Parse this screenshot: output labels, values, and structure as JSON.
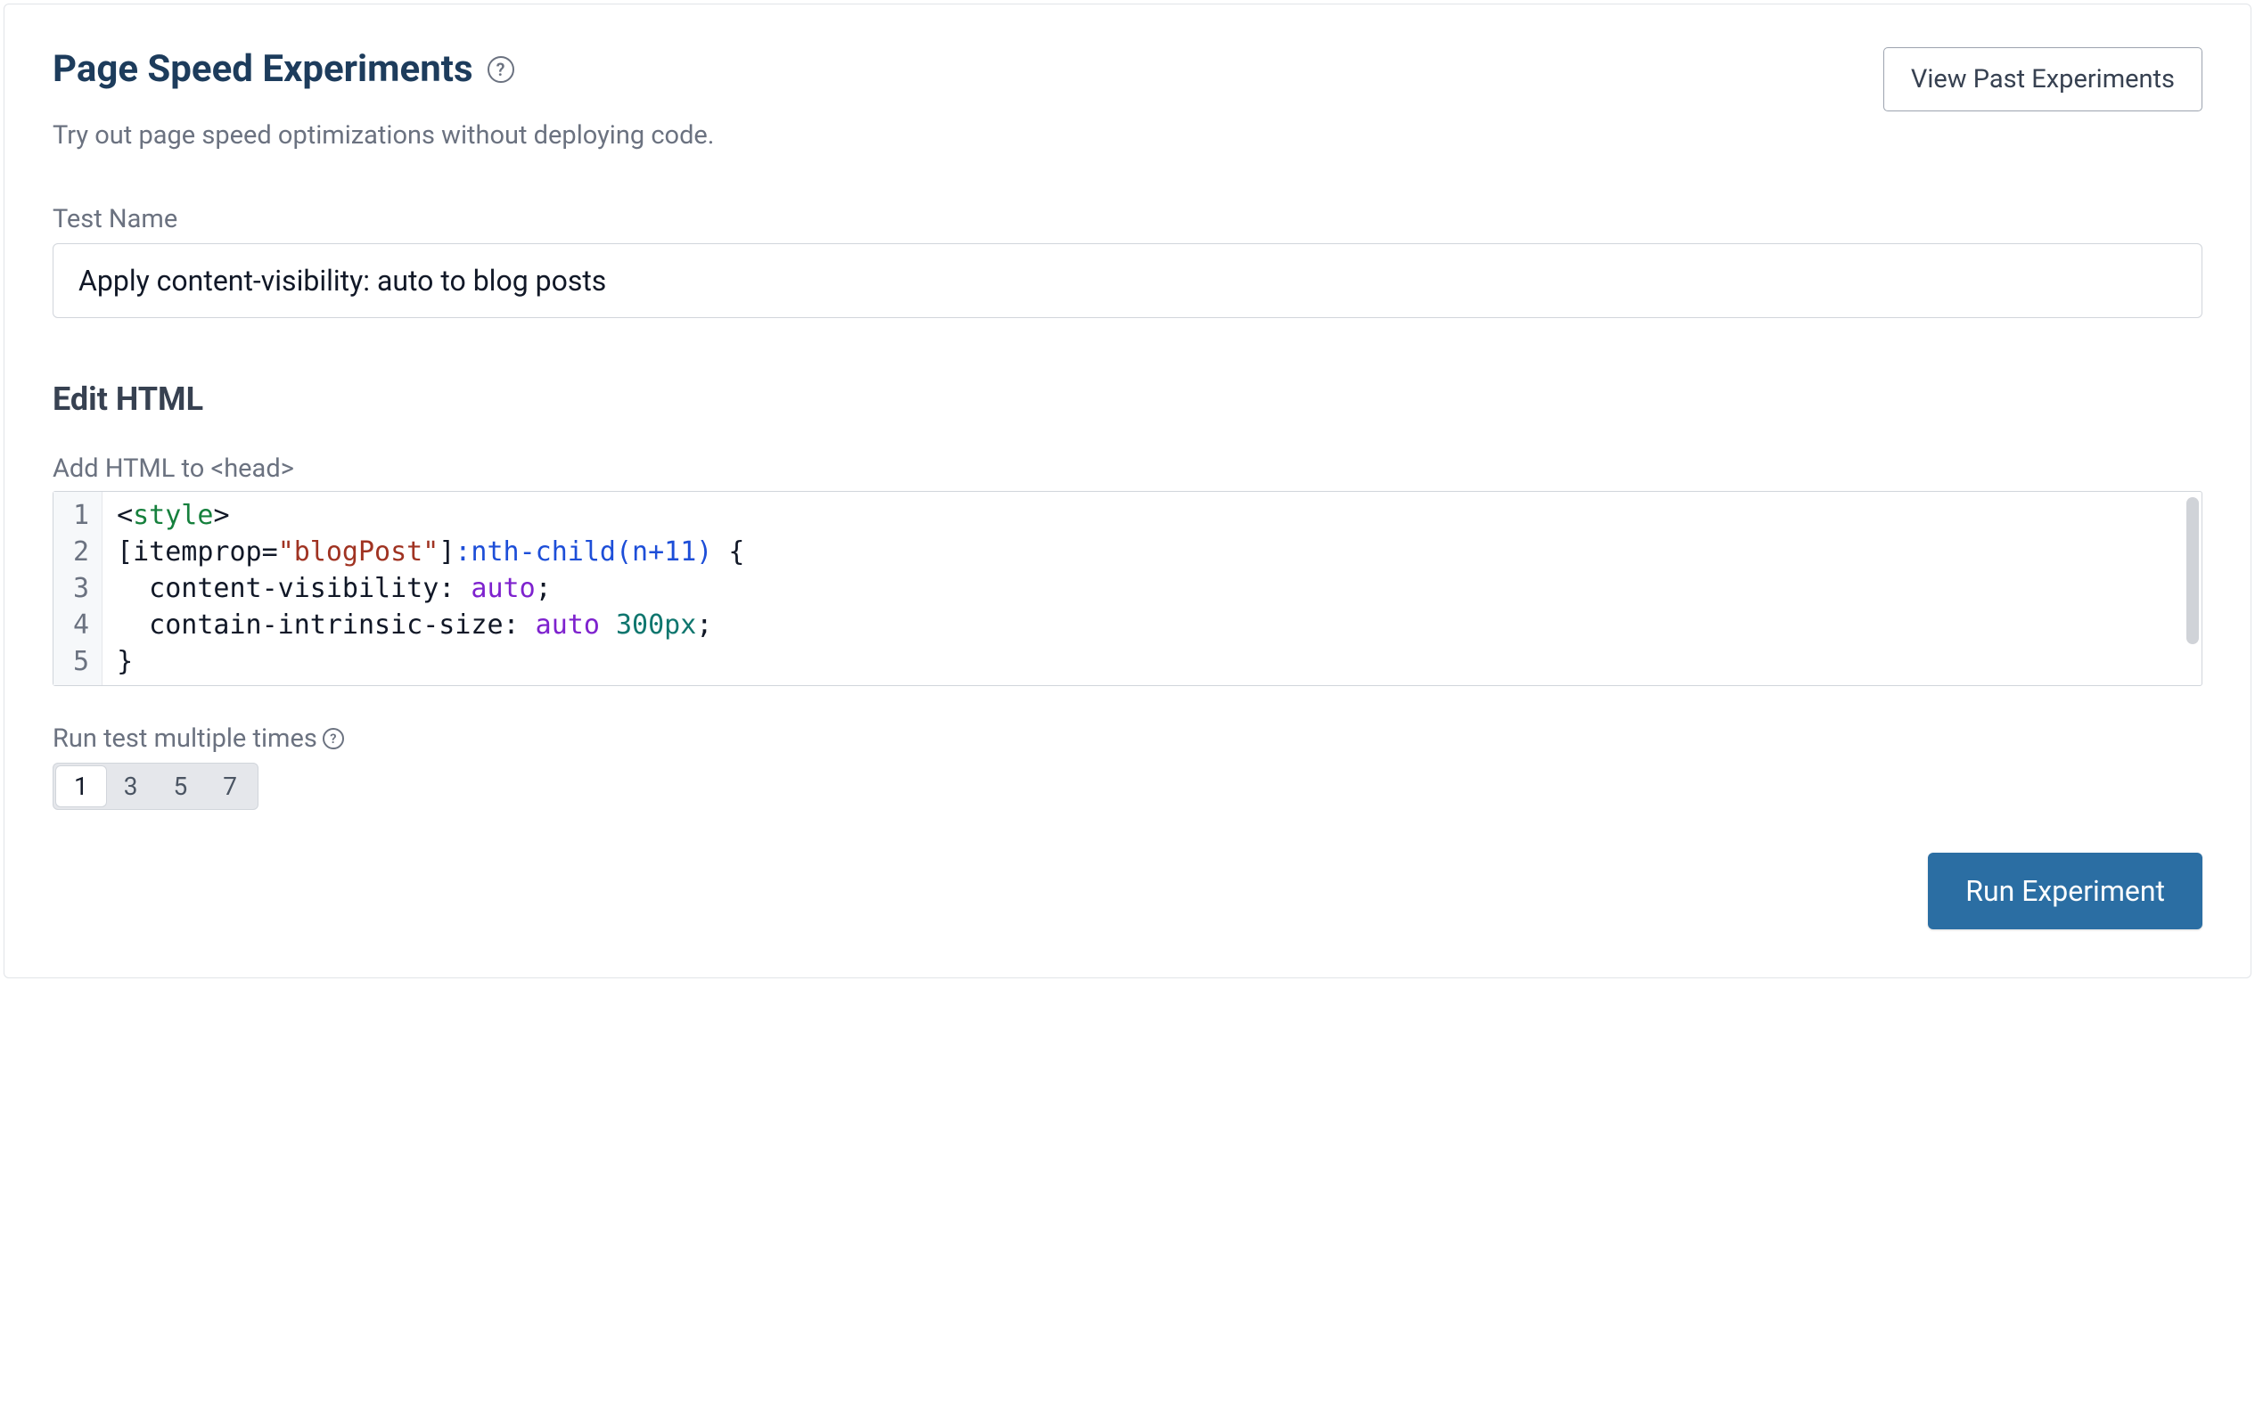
{
  "header": {
    "title": "Page Speed Experiments",
    "subtitle": "Try out page speed optimizations without deploying code.",
    "view_past_label": "View Past Experiments"
  },
  "test_name": {
    "label": "Test Name",
    "value": "Apply content-visibility: auto to blog posts"
  },
  "edit_html": {
    "section_title": "Edit HTML",
    "editor_label": "Add HTML to <head>",
    "lines": [
      {
        "n": "1",
        "tokens": [
          {
            "t": "<",
            "c": "tok-punc"
          },
          {
            "t": "style",
            "c": "tok-tag"
          },
          {
            "t": ">",
            "c": "tok-punc"
          }
        ]
      },
      {
        "n": "2",
        "tokens": [
          {
            "t": "[itemprop=",
            "c": ""
          },
          {
            "t": "\"blogPost\"",
            "c": "tok-attrval"
          },
          {
            "t": "]",
            "c": ""
          },
          {
            "t": ":nth-child(n+11)",
            "c": "tok-pseudo"
          },
          {
            "t": " {",
            "c": ""
          }
        ]
      },
      {
        "n": "3",
        "tokens": [
          {
            "t": "  content-visibility: ",
            "c": ""
          },
          {
            "t": "auto",
            "c": "tok-value"
          },
          {
            "t": ";",
            "c": ""
          }
        ]
      },
      {
        "n": "4",
        "tokens": [
          {
            "t": "  contain-intrinsic-size: ",
            "c": ""
          },
          {
            "t": "auto",
            "c": "tok-value"
          },
          {
            "t": " ",
            "c": ""
          },
          {
            "t": "300px",
            "c": "tok-num"
          },
          {
            "t": ";",
            "c": ""
          }
        ]
      },
      {
        "n": "5",
        "tokens": [
          {
            "t": "}",
            "c": ""
          }
        ]
      }
    ]
  },
  "run_multiple": {
    "label": "Run test multiple times",
    "options": [
      "1",
      "3",
      "5",
      "7"
    ],
    "selected": "1"
  },
  "footer": {
    "run_label": "Run Experiment"
  }
}
